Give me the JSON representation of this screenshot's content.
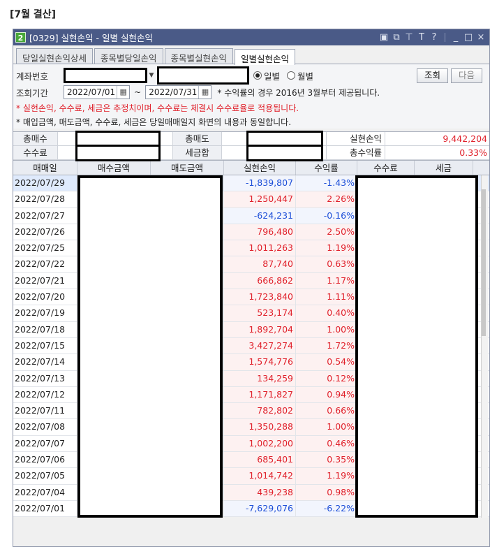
{
  "page_heading": "[7월 결산]",
  "window": {
    "badge": "2",
    "title": "[0329] 실현손익 - 일별 실현손익",
    "controls": [
      "restore-window",
      "new-window",
      "pin",
      "font-size",
      "help",
      "minimize",
      "maximize",
      "close"
    ]
  },
  "tabs": [
    {
      "label": "당일실현손익상세",
      "active": false
    },
    {
      "label": "종목별당일손익",
      "active": false
    },
    {
      "label": "종목별실현손익",
      "active": false
    },
    {
      "label": "일별실현손익",
      "active": true
    }
  ],
  "filters": {
    "account_label": "계좌번호",
    "radio_daily": "일별",
    "radio_monthly": "월별",
    "radio_selected": "daily",
    "search_button": "조회",
    "next_button": "다음",
    "period_label": "조회기간",
    "start_date": "2022/07/01",
    "date_separator": "~",
    "end_date": "2022/07/31",
    "period_note": "* 수익률의 경우 2016년 3월부터 제공됩니다.",
    "warning_note": "* 실현손익, 수수료, 세금은 추정치이며, 수수료는 체결시 수수료율로 적용됩니다.",
    "info_note": "* 매입금액, 매도금액, 수수료, 세금은 당일매매일지 화면의 내용과 동일합니다."
  },
  "summary": {
    "total_buy_label": "총매수",
    "total_sell_label": "총매도",
    "realized_pnl_label": "실현손익",
    "realized_pnl_value": "9,442,204",
    "fee_label": "수수료",
    "tax_total_label": "세금합",
    "total_return_label": "총수익률",
    "total_return_value": "0.33%"
  },
  "grid": {
    "headers": [
      "매매일",
      "매수금액",
      "매도금액",
      "실현손익",
      "수익률",
      "수수료",
      "세금"
    ],
    "rows": [
      {
        "date": "2022/07/29",
        "pnl": "-1,839,807",
        "rate": "-1.43%",
        "dir": "down"
      },
      {
        "date": "2022/07/28",
        "pnl": "1,250,447",
        "rate": "2.26%",
        "dir": "up"
      },
      {
        "date": "2022/07/27",
        "pnl": "-624,231",
        "rate": "-0.16%",
        "dir": "down"
      },
      {
        "date": "2022/07/26",
        "pnl": "796,480",
        "rate": "2.50%",
        "dir": "up"
      },
      {
        "date": "2022/07/25",
        "pnl": "1,011,263",
        "rate": "1.19%",
        "dir": "up"
      },
      {
        "date": "2022/07/22",
        "pnl": "87,740",
        "rate": "0.63%",
        "dir": "up"
      },
      {
        "date": "2022/07/21",
        "pnl": "666,862",
        "rate": "1.17%",
        "dir": "up"
      },
      {
        "date": "2022/07/20",
        "pnl": "1,723,840",
        "rate": "1.11%",
        "dir": "up"
      },
      {
        "date": "2022/07/19",
        "pnl": "523,174",
        "rate": "0.40%",
        "dir": "up"
      },
      {
        "date": "2022/07/18",
        "pnl": "1,892,704",
        "rate": "1.00%",
        "dir": "up"
      },
      {
        "date": "2022/07/15",
        "pnl": "3,427,274",
        "rate": "1.72%",
        "dir": "up"
      },
      {
        "date": "2022/07/14",
        "pnl": "1,574,776",
        "rate": "0.54%",
        "dir": "up"
      },
      {
        "date": "2022/07/13",
        "pnl": "134,259",
        "rate": "0.12%",
        "dir": "up"
      },
      {
        "date": "2022/07/12",
        "pnl": "1,171,827",
        "rate": "0.94%",
        "dir": "up"
      },
      {
        "date": "2022/07/11",
        "pnl": "782,802",
        "rate": "0.66%",
        "dir": "up"
      },
      {
        "date": "2022/07/08",
        "pnl": "1,350,288",
        "rate": "1.00%",
        "dir": "up"
      },
      {
        "date": "2022/07/07",
        "pnl": "1,002,200",
        "rate": "0.46%",
        "dir": "up"
      },
      {
        "date": "2022/07/06",
        "pnl": "685,401",
        "rate": "0.35%",
        "dir": "up"
      },
      {
        "date": "2022/07/05",
        "pnl": "1,014,742",
        "rate": "1.19%",
        "dir": "up"
      },
      {
        "date": "2022/07/04",
        "pnl": "439,238",
        "rate": "0.98%",
        "dir": "up"
      },
      {
        "date": "2022/07/01",
        "pnl": "-7,629,076",
        "rate": "-6.22%",
        "dir": "down"
      }
    ]
  },
  "colors": {
    "titlebar": "#4a5a87",
    "profit": "#e0202a",
    "loss": "#1d4fd8",
    "selected_row": "#dfeafc"
  }
}
